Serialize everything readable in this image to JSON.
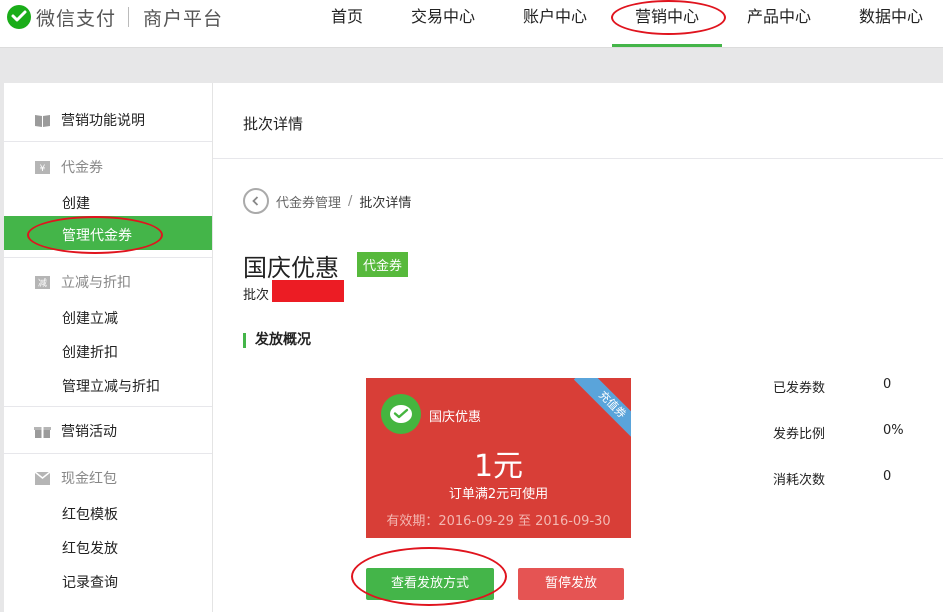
{
  "brand": {
    "name": "微信支付",
    "subtitle": "商户平台"
  },
  "nav": [
    {
      "label": "首页"
    },
    {
      "label": "交易中心"
    },
    {
      "label": "账户中心"
    },
    {
      "label": "营销中心",
      "active": true
    },
    {
      "label": "产品中心"
    },
    {
      "label": "数据中心"
    }
  ],
  "sidebar": {
    "intro": "营销功能说明",
    "voucher": {
      "title": "代金券",
      "items": [
        "创建",
        "管理代金券"
      ]
    },
    "discount": {
      "title": "立减与折扣",
      "items": [
        "创建立减",
        "创建折扣",
        "管理立减与折扣"
      ]
    },
    "activity": "营销活动",
    "redpacket": {
      "title": "现金红包",
      "items": [
        "红包模板",
        "红包发放",
        "记录查询"
      ]
    },
    "active_item": "管理代金券"
  },
  "main": {
    "header": "批次详情",
    "breadcrumb": {
      "parent": "代金券管理",
      "separator": "/",
      "current": "批次详情"
    },
    "title": "国庆优惠",
    "tag": "代金券",
    "batch_label": "批次",
    "section": "发放概况",
    "coupon": {
      "name": "国庆优惠",
      "value": "1元",
      "condition": "订单满2元可使用",
      "validity": "有效期：2016-09-29 至 2016-09-30",
      "ribbon": "充值券"
    },
    "stats": [
      {
        "label": "已发券数",
        "value": "0"
      },
      {
        "label": "发券比例",
        "value": "0%"
      },
      {
        "label": "消耗次数",
        "value": "0"
      }
    ],
    "buttons": {
      "view": "查看发放方式",
      "pause": "暂停发放"
    }
  },
  "colors": {
    "accent": "#44b549",
    "coupon": "#d83e37",
    "danger": "#e55453",
    "annotation": "#e0141e"
  }
}
